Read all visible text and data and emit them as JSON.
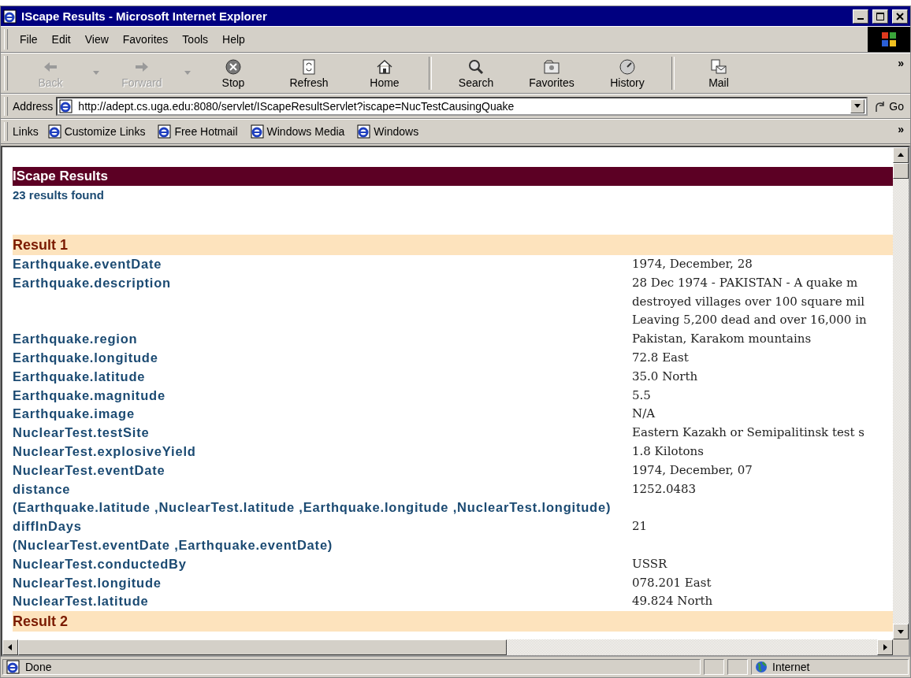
{
  "window": {
    "title": "IScape Results - Microsoft Internet Explorer"
  },
  "menu": [
    "File",
    "Edit",
    "View",
    "Favorites",
    "Tools",
    "Help"
  ],
  "toolbar": {
    "buttons": [
      {
        "label": "Back",
        "kind": "back",
        "disabled": true,
        "dropdown": true
      },
      {
        "label": "Forward",
        "kind": "forward",
        "disabled": true,
        "dropdown": true
      },
      {
        "label": "Stop",
        "kind": "stop",
        "disabled": false,
        "dropdown": false
      },
      {
        "label": "Refresh",
        "kind": "refresh",
        "disabled": false,
        "dropdown": false
      },
      {
        "label": "Home",
        "kind": "home",
        "disabled": false,
        "dropdown": false
      },
      {
        "label": "Search",
        "kind": "search",
        "disabled": false,
        "dropdown": false
      },
      {
        "label": "Favorites",
        "kind": "favorites",
        "disabled": false,
        "dropdown": false
      },
      {
        "label": "History",
        "kind": "history",
        "disabled": false,
        "dropdown": false
      },
      {
        "label": "Mail",
        "kind": "mail",
        "disabled": false,
        "dropdown": false
      }
    ],
    "more": "»"
  },
  "address": {
    "label": "Address",
    "value": "http://adept.cs.uga.edu:8080/servlet/IScapeResultServlet?iscape=NucTestCausingQuake",
    "go": "Go"
  },
  "links": {
    "label": "Links",
    "items": [
      "Customize Links",
      "Free Hotmail",
      "Windows Media",
      "Windows"
    ],
    "more": "»"
  },
  "page": {
    "heading": "IScape Results",
    "count": "23 results found",
    "results": [
      {
        "title": "Result 1",
        "fields": [
          {
            "label_lines": [
              "Earthquake.eventDate"
            ],
            "value_lines": [
              "1974, December, 28"
            ]
          },
          {
            "label_lines": [
              "Earthquake.description"
            ],
            "value_lines": [
              "28 Dec 1974 - PAKISTAN - A quake m",
              "destroyed villages over 100 square mil",
              "Leaving 5,200 dead and over 16,000 in"
            ]
          },
          {
            "label_lines": [
              "Earthquake.region"
            ],
            "value_lines": [
              "Pakistan, Karakom mountains"
            ]
          },
          {
            "label_lines": [
              "Earthquake.longitude"
            ],
            "value_lines": [
              "72.8 East"
            ]
          },
          {
            "label_lines": [
              "Earthquake.latitude"
            ],
            "value_lines": [
              "35.0 North"
            ]
          },
          {
            "label_lines": [
              "Earthquake.magnitude"
            ],
            "value_lines": [
              "5.5"
            ]
          },
          {
            "label_lines": [
              "Earthquake.image"
            ],
            "value_lines": [
              "N/A"
            ]
          },
          {
            "label_lines": [
              "NuclearTest.testSite"
            ],
            "value_lines": [
              "Eastern Kazakh or Semipalitinsk test s"
            ]
          },
          {
            "label_lines": [
              "NuclearTest.explosiveYield"
            ],
            "value_lines": [
              "1.8 Kilotons"
            ]
          },
          {
            "label_lines": [
              "NuclearTest.eventDate"
            ],
            "value_lines": [
              "1974, December, 07"
            ]
          },
          {
            "label_lines": [
              "distance",
              "(Earthquake.latitude ,NuclearTest.latitude ,Earthquake.longitude ,NuclearTest.longitude)"
            ],
            "value_lines": [
              "1252.0483"
            ]
          },
          {
            "label_lines": [
              "diffInDays",
              "(NuclearTest.eventDate ,Earthquake.eventDate)"
            ],
            "value_lines": [
              "21"
            ]
          },
          {
            "label_lines": [
              "NuclearTest.conductedBy"
            ],
            "value_lines": [
              "USSR"
            ]
          },
          {
            "label_lines": [
              "NuclearTest.longitude"
            ],
            "value_lines": [
              "078.201 East"
            ]
          },
          {
            "label_lines": [
              "NuclearTest.latitude"
            ],
            "value_lines": [
              "49.824 North"
            ]
          }
        ]
      },
      {
        "title": "Result 2"
      }
    ]
  },
  "status_bar": {
    "text": "Done",
    "zone": "Internet"
  }
}
